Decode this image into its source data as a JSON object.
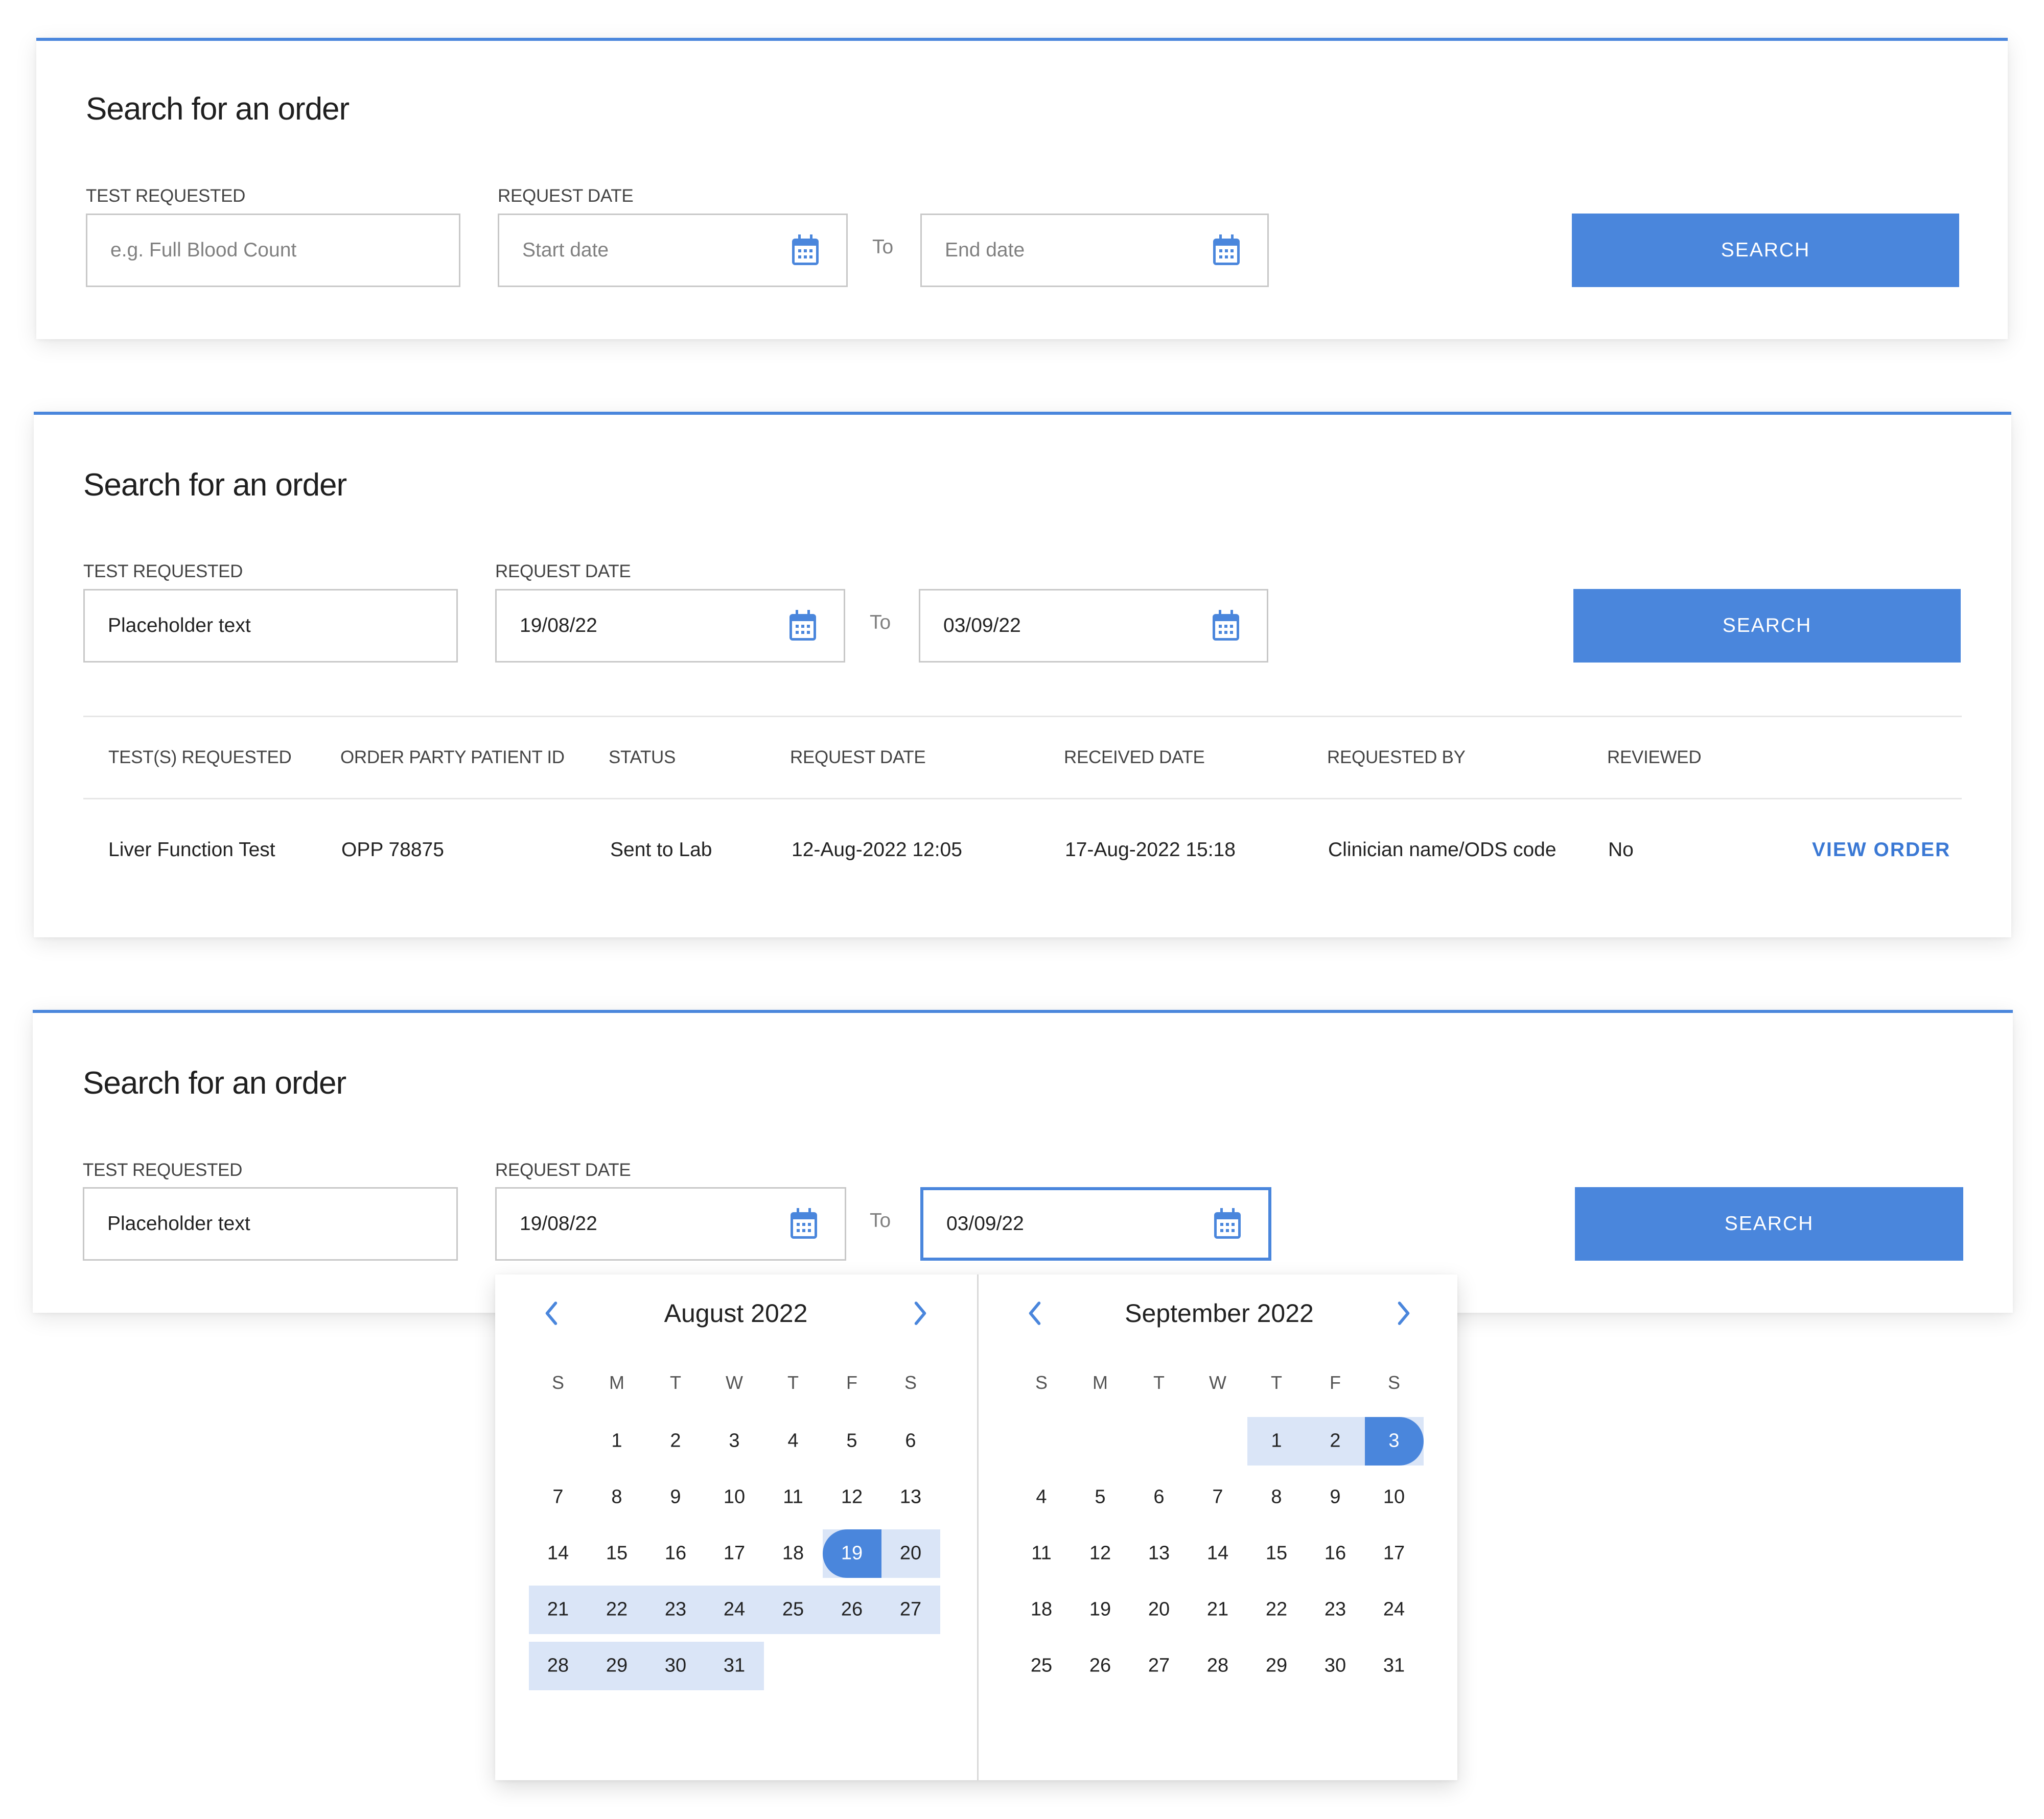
{
  "accent_color": "#4a86dc",
  "range_color": "#dae5f7",
  "cards": [
    {
      "title": "Search for an order",
      "test_label": "TEST REQUESTED",
      "test_value": "",
      "test_placeholder": "e.g. Full Blood Count",
      "date_label": "REQUEST DATE",
      "start_value": "",
      "start_placeholder": "Start date",
      "to_label": "To",
      "end_value": "",
      "end_placeholder": "End date",
      "search_label": "SEARCH"
    },
    {
      "title": "Search for an order",
      "test_label": "TEST REQUESTED",
      "test_value": "Placeholder text",
      "date_label": "REQUEST DATE",
      "start_value": "19/08/22",
      "to_label": "To",
      "end_value": "03/09/22",
      "search_label": "SEARCH",
      "table": {
        "headers": [
          "TEST(S) REQUESTED",
          "ORDER PARTY PATIENT ID",
          "STATUS",
          "REQUEST DATE",
          "RECEIVED DATE",
          "REQUESTED BY",
          "REVIEWED"
        ],
        "rows": [
          {
            "cells": [
              "Liver Function Test",
              "OPP 78875",
              "Sent to Lab",
              "12-Aug-2022 12:05",
              "17-Aug-2022 15:18",
              "Clinician name/ODS code",
              "No"
            ],
            "action": "VIEW ORDER"
          }
        ]
      }
    },
    {
      "title": "Search for an order",
      "test_label": "TEST REQUESTED",
      "test_value": "Placeholder text",
      "date_label": "REQUEST DATE",
      "start_value": "19/08/22",
      "to_label": "To",
      "end_value": "03/09/22",
      "search_label": "SEARCH"
    }
  ],
  "calendar": {
    "weekdays": [
      "S",
      "M",
      "T",
      "W",
      "T",
      "F",
      "S"
    ],
    "months": [
      {
        "title": "August 2022",
        "first_weekday": 1,
        "days_in_month": 31,
        "range_start": 19,
        "range_end": 31,
        "selected": 19
      },
      {
        "title": "September 2022",
        "first_weekday": 4,
        "days_in_month": 31,
        "range_start": 1,
        "range_end": 3,
        "selected": 3
      }
    ],
    "prev_icon": "chevron-left-icon",
    "next_icon": "chevron-right-icon"
  }
}
